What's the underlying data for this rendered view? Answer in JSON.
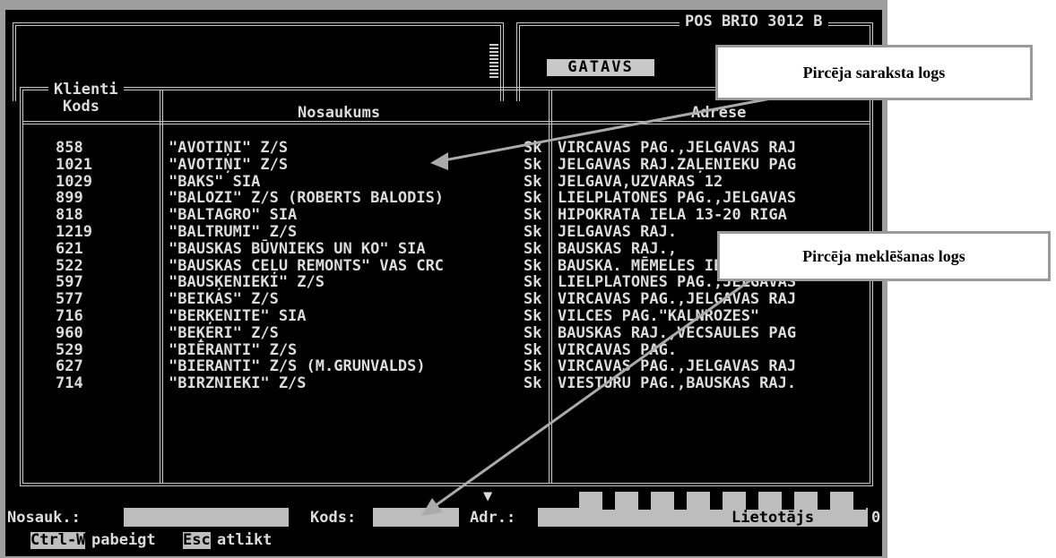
{
  "header": {
    "device": "POS BRIO 3012 B",
    "status": "GATAVS"
  },
  "window": {
    "title": "Klienti"
  },
  "columns": {
    "code": "Kods",
    "name": "Nosaukums",
    "address": "Adrese"
  },
  "rows": [
    {
      "code": "858",
      "name": "\"AVOTIŅI\" Z/S",
      "flag": "Sk",
      "address": "VIRCAVAS PAG.,JELGAVAS RAJ"
    },
    {
      "code": "1021",
      "name": "\"AVOTIŅI\" Z/S",
      "flag": "Sk",
      "address": "JELGAVAS RAJ.ZAĻENIEKU PAG"
    },
    {
      "code": "1029",
      "name": "\"BAKS\" SIA",
      "flag": "Sk",
      "address": "JELGAVA,UZVARAS 12"
    },
    {
      "code": "899",
      "name": "\"BALOZI\" Z/S (ROBERTS BALODIS)",
      "flag": "Sk",
      "address": "LIELPLATONES PAG.,JELGAVAS"
    },
    {
      "code": "818",
      "name": "\"BALTAGRO\" SIA",
      "flag": "Sk",
      "address": "HIPOKRATA IELA 13-20 RIGA"
    },
    {
      "code": "1219",
      "name": "\"BALTRUMI\" Z/S",
      "flag": "Sk",
      "address": "JELGAVAS RAJ."
    },
    {
      "code": "621",
      "name": "\"BAUSKAS BŪVNIEKS UN KO\" SIA",
      "flag": "Sk",
      "address": "BAUSKAS RAJ.,"
    },
    {
      "code": "522",
      "name": "\"BAUSKAS CEĻU REMONTS\" VAS CRC",
      "flag": "Sk",
      "address": "BAUSKA. MĒMELES IELA 3."
    },
    {
      "code": "597",
      "name": "\"BAUSĶENIEKI\" Z/S",
      "flag": "Sk",
      "address": "LIELPLATONES PAG.,JELGAVAS"
    },
    {
      "code": "577",
      "name": "\"BEIKAS\" Z/S",
      "flag": "Sk",
      "address": "VIRCAVAS PAG.,JELGAVAS RAJ"
    },
    {
      "code": "716",
      "name": "\"BERĶENITE\" SIA",
      "flag": "Sk",
      "address": "VILCES PAG.\"KALNROZES\""
    },
    {
      "code": "960",
      "name": "\"BEĶERI\" Z/S",
      "flag": "Sk",
      "address": "BAUSKAS RAJ.,VECSAULES PAG"
    },
    {
      "code": "529",
      "name": "\"BIĒRANTI\" Z/S",
      "flag": "Sk",
      "address": "VIRCAVAS PAG."
    },
    {
      "code": "627",
      "name": "\"BIERANTI\" Z/S (M.GRUNVALDS)",
      "flag": "Sk",
      "address": "VIRCAVAS PAG.,JELGAVAS RAJ"
    },
    {
      "code": "714",
      "name": "\"BIRZNIEKI\" Z/S",
      "flag": "Sk",
      "address": "VIESTURU PAG.,BAUSKAS RAJ."
    }
  ],
  "search": {
    "name_label": "Nosauk.:",
    "code_label": "Kods:",
    "address_label": "Adr.:",
    "user_label": "Lietotājs",
    "user_value": "0"
  },
  "footer": {
    "key1": "Ctrl-W",
    "action1": "pabeigt",
    "key2": "Esc",
    "action2": "atlikt"
  },
  "callouts": {
    "list_window": "Pircēja saraksta logs",
    "search_window": "Pircēja meklēšanas logs"
  }
}
